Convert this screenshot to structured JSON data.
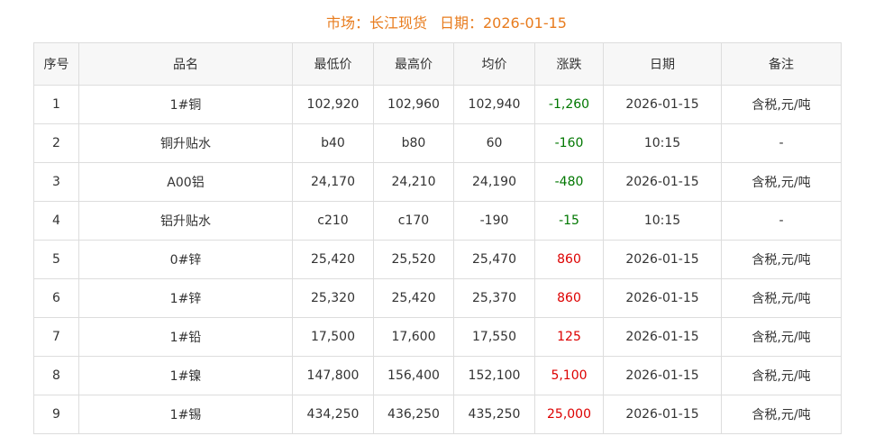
{
  "header": {
    "market": "市场：长江现货",
    "date": "日期：2026-01-15"
  },
  "columns": [
    "序号",
    "品名",
    "最低价",
    "最高价",
    "均价",
    "涨跌",
    "日期",
    "备注"
  ],
  "rows": [
    {
      "no": "1",
      "name": "1#铜",
      "low": "102,920",
      "high": "102,960",
      "avg": "102,940",
      "change": "-1,260",
      "dir": "down",
      "date": "2026-01-15",
      "note": "含税,元/吨"
    },
    {
      "no": "2",
      "name": "铜升贴水",
      "low": "b40",
      "high": "b80",
      "avg": "60",
      "change": "-160",
      "dir": "down",
      "date": "10:15",
      "note": "-"
    },
    {
      "no": "3",
      "name": "A00铝",
      "low": "24,170",
      "high": "24,210",
      "avg": "24,190",
      "change": "-480",
      "dir": "down",
      "date": "2026-01-15",
      "note": "含税,元/吨"
    },
    {
      "no": "4",
      "name": "铝升贴水",
      "low": "c210",
      "high": "c170",
      "avg": "-190",
      "change": "-15",
      "dir": "down",
      "date": "10:15",
      "note": "-"
    },
    {
      "no": "5",
      "name": "0#锌",
      "low": "25,420",
      "high": "25,520",
      "avg": "25,470",
      "change": "860",
      "dir": "up",
      "date": "2026-01-15",
      "note": "含税,元/吨"
    },
    {
      "no": "6",
      "name": "1#锌",
      "low": "25,320",
      "high": "25,420",
      "avg": "25,370",
      "change": "860",
      "dir": "up",
      "date": "2026-01-15",
      "note": "含税,元/吨"
    },
    {
      "no": "7",
      "name": "1#铅",
      "low": "17,500",
      "high": "17,600",
      "avg": "17,550",
      "change": "125",
      "dir": "up",
      "date": "2026-01-15",
      "note": "含税,元/吨"
    },
    {
      "no": "8",
      "name": "1#镍",
      "low": "147,800",
      "high": "156,400",
      "avg": "152,100",
      "change": "5,100",
      "dir": "up",
      "date": "2026-01-15",
      "note": "含税,元/吨"
    },
    {
      "no": "9",
      "name": "1#锡",
      "low": "434,250",
      "high": "436,250",
      "avg": "435,250",
      "change": "25,000",
      "dir": "up",
      "date": "2026-01-15",
      "note": "含税,元/吨"
    }
  ],
  "colors": {
    "title": "#e87c1e",
    "up": "#dd0000",
    "down": "#007700",
    "border": "#dddddd",
    "header_bg": "#f7f7f7"
  }
}
